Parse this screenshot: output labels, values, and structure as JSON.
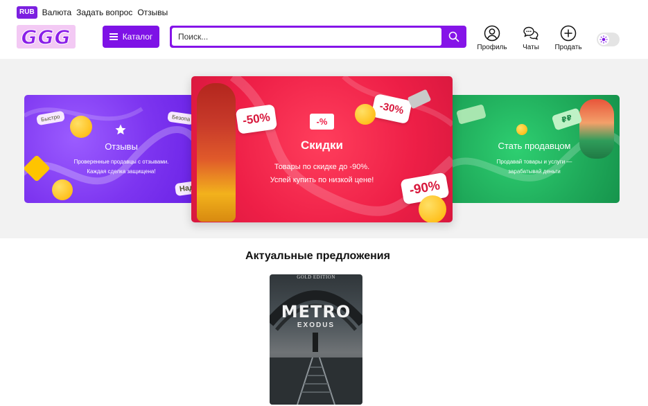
{
  "topbar": {
    "currency_badge": "RUB",
    "links": [
      "Валюта",
      "Задать вопрос",
      "Отзывы"
    ]
  },
  "header": {
    "logo_text": "GGG",
    "catalog_label": "Каталог",
    "search_placeholder": "Поиск...",
    "nav": {
      "profile": "Профиль",
      "chats": "Чаты",
      "sell": "Продать"
    }
  },
  "banners": {
    "left": {
      "title": "Отзывы",
      "text_line1": "Проверенные продавцы с отзывами.",
      "text_line2": "Каждая сделка защищена!",
      "pills": [
        "Быстро",
        "Безопа",
        "Над"
      ]
    },
    "center": {
      "badge": "-%",
      "title": "Скидки",
      "text_line1": "Товары по скидке до -90%.",
      "text_line2": "Успей купить по низкой цене!",
      "tags": [
        "-50%",
        "-30%",
        "-90%"
      ]
    },
    "right": {
      "title": "Стать продавцом",
      "text_line1": "Продавай товары и услуги —",
      "text_line2": "зарабатывай деньги",
      "coin_symbol": "₽₽"
    }
  },
  "section": {
    "title": "Актуальные предложения"
  },
  "product": {
    "edition": "GOLD EDITION",
    "title": "METRO",
    "subtitle": "EXODUS"
  },
  "colors": {
    "brand": "#7e12e6",
    "logo_bg": "#f3c9f4",
    "banner_left": "#7d35f0",
    "banner_center": "#ee1f47",
    "banner_right": "#1faa5a"
  }
}
